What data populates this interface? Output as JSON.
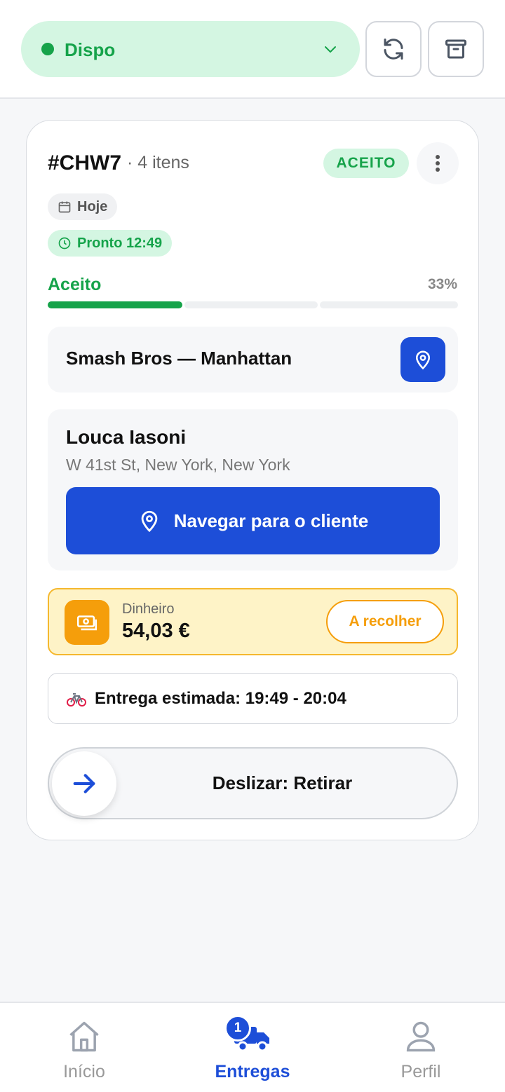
{
  "header": {
    "status_label": "Dispo",
    "refresh_icon": "refresh-icon",
    "archive_icon": "archive-icon"
  },
  "order": {
    "id": "#CHW7",
    "item_count": "· 4 itens",
    "status_badge": "ACEITO",
    "day_chip": "Hoje",
    "ready_chip": "Pronto 12:49",
    "progress_label": "Aceito",
    "progress_percent_text": "33%",
    "progress_value": 0.33,
    "restaurant": "Smash Bros — Manhattan",
    "customer_name": "Louca Iasoni",
    "customer_address": "W 41st St, New York, New York",
    "navigate_label": "Navegar para o cliente",
    "payment_method": "Dinheiro",
    "payment_amount": "54,03 €",
    "collect_label": "A recolher",
    "eta_text": "Entrega estimada: 19:49 - 20:04",
    "slide_label": "Deslizar: Retirar"
  },
  "colors": {
    "green": "#16a34a",
    "blue": "#1d4ed8",
    "amber": "#f59e0b"
  },
  "bottom_nav": {
    "items": [
      {
        "label": "Início",
        "icon": "home-icon"
      },
      {
        "label": "Entregas",
        "icon": "truck-icon",
        "badge": "1"
      },
      {
        "label": "Perfil",
        "icon": "user-icon"
      }
    ]
  }
}
